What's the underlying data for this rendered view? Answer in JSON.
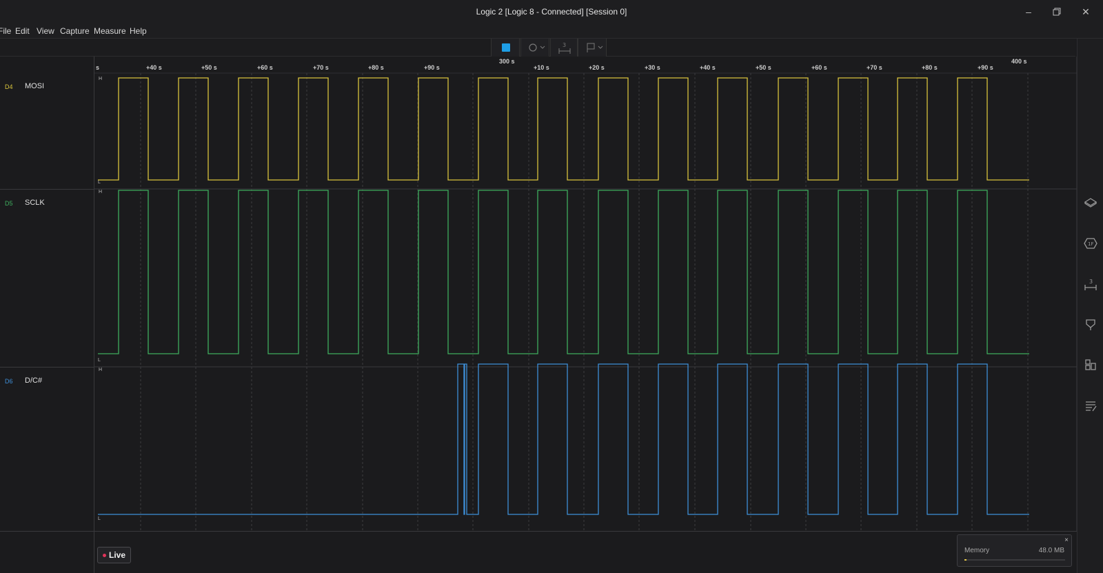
{
  "window": {
    "title": "Logic 2 [Logic 8 - Connected] [Session 0]",
    "minimize_icon": "minimize-icon",
    "maximize_icon": "restore-icon",
    "close_icon": "close-icon"
  },
  "menu": [
    "File",
    "Edit",
    "View",
    "Capture",
    "Measure",
    "Help"
  ],
  "toolbar": {
    "buttons": [
      "stop-capture-button",
      "trigger-button",
      "measure-button",
      "marker-button"
    ],
    "stop_color": "#1e9ee6"
  },
  "timeline": {
    "ticks_a": [
      "s",
      "+40 s",
      "+50 s",
      "+60 s",
      "+70 s",
      "+80 s",
      "+90 s"
    ],
    "major_a": "300 s",
    "ticks_b": [
      "+10 s",
      "+20 s",
      "+30 s",
      "+40 s",
      "+50 s",
      "+60 s",
      "+70 s",
      "+80 s",
      "+90 s"
    ],
    "major_b": "400 s"
  },
  "channels": [
    {
      "num": "D4",
      "name": "MOSI",
      "color": "#d9c43c"
    },
    {
      "num": "D5",
      "name": "SCLK",
      "color": "#3fae5e"
    },
    {
      "num": "D6",
      "name": "D/C#",
      "color": "#3e8fd8"
    }
  ],
  "level_labels": {
    "high": "H",
    "low": "L"
  },
  "right_icons": [
    "analyzers-icon",
    "hex-display-icon",
    "timing-marker-icon",
    "notes-icon",
    "extensions-icon",
    "log-icon"
  ],
  "live": {
    "label": "Live",
    "dot_color": "#e0345a"
  },
  "memory": {
    "label": "Memory",
    "value": "48.0 MB",
    "close": "×",
    "fill_fraction": 0.02,
    "fill_color": "#e6c84a"
  }
}
